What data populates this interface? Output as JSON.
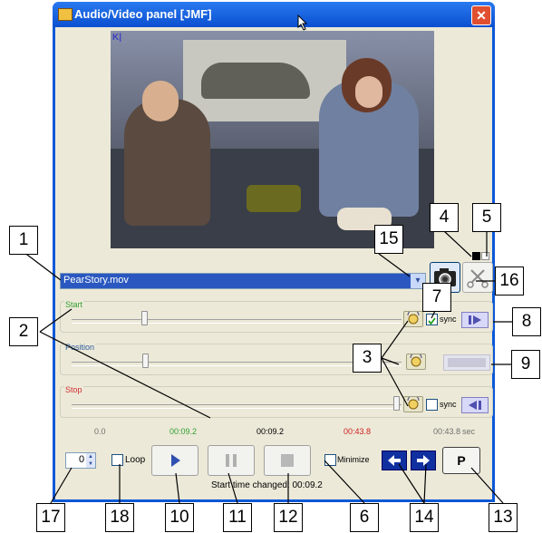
{
  "window": {
    "title": "Audio/Video panel [JMF]",
    "close_glyph": "✕"
  },
  "video": {
    "corner_mark": "K|"
  },
  "file_selector": {
    "value": "PearStory.mov",
    "arrow": "▾"
  },
  "start": {
    "label": "Start",
    "label_color": "#33a033",
    "sync_label": "sync",
    "sync_checked": true
  },
  "position": {
    "label": "Position",
    "label_color": "#3060a0"
  },
  "stop": {
    "label": "Stop",
    "label_color": "#d03030",
    "sync_label": "sync",
    "sync_checked": false
  },
  "timeline": {
    "begin": "0.0",
    "start": "00:09.2",
    "position": "00:09.2",
    "stop": "00:43.8",
    "end": "00:43.8",
    "unit": "sec",
    "start_color": "#33a033",
    "stop_color": "#d02020"
  },
  "controls": {
    "spinner_value": "0",
    "loop_label": "Loop",
    "minimize_label": "Minimize",
    "p_label": "P"
  },
  "status": {
    "text": "Start time changed: 00:09.2"
  },
  "callouts": [
    "1",
    "2",
    "3",
    "4",
    "5",
    "6",
    "7",
    "8",
    "9",
    "10",
    "11",
    "12",
    "13",
    "14",
    "15",
    "16",
    "17",
    "18"
  ]
}
